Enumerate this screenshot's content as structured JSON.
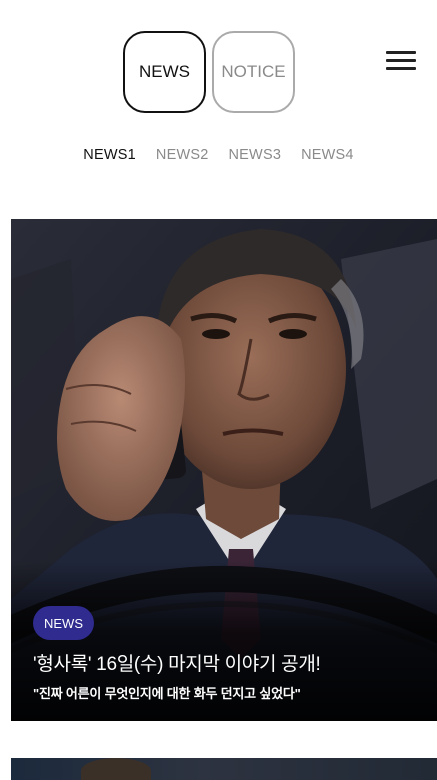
{
  "header": {
    "tabs": [
      {
        "label": "NEWS",
        "active": true
      },
      {
        "label": "NOTICE",
        "active": false
      }
    ],
    "menu_icon": "hamburger-menu-icon"
  },
  "subtabs": [
    {
      "label": "NEWS1",
      "active": true
    },
    {
      "label": "NEWS2",
      "active": false
    },
    {
      "label": "NEWS3",
      "active": false
    },
    {
      "label": "NEWS4",
      "active": false
    }
  ],
  "featured": {
    "badge": "NEWS",
    "title": "'형사록' 16일(수) 마지막 이야기 공개!",
    "subtitle": "\"진짜 어른이 무엇인지에 대한 화두 던지고 싶었다\""
  },
  "colors": {
    "badge_bg": "#2f2b8f",
    "active_text": "#111111",
    "inactive_text": "#8a8a8a"
  }
}
